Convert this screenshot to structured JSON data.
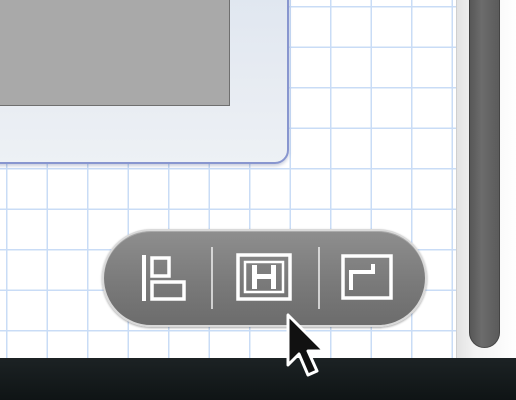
{
  "window": {
    "background": "#ffffff",
    "grid_color": "#c9dcf6"
  },
  "hud": {
    "buttons": [
      {
        "name": "align-left",
        "icon": "align-left-icon"
      },
      {
        "name": "align-center",
        "icon": "align-center-icon"
      },
      {
        "name": "align-top-right",
        "icon": "align-top-right-icon"
      }
    ],
    "background": "#7f7f7f",
    "icon_color": "#ffffff"
  },
  "scrollbar": {
    "thumb_color": "#5e5e5e"
  },
  "cursor": {
    "icon": "arrow-cursor-icon"
  }
}
